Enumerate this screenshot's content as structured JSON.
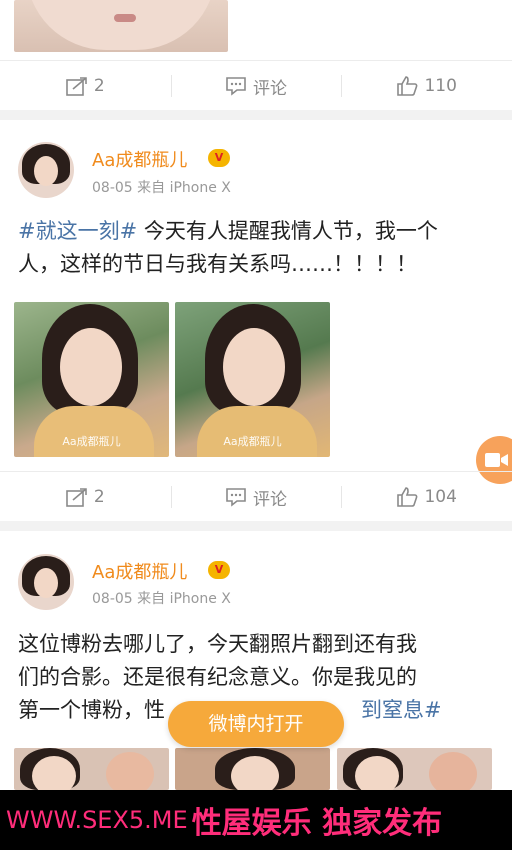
{
  "post1": {
    "actions": {
      "repost_count": "2",
      "comment_label": "评论",
      "like_count": "110"
    }
  },
  "post2": {
    "username": "Aa成都瓶儿",
    "badge": "V",
    "meta": "08-05 来自 iPhone X",
    "hashtag": "#就这一刻#",
    "text_line1_rest": " 今天有人提醒我情人节，我一个",
    "text_line2": "人，这样的节日与我有关系吗……！！！！",
    "images": [
      {
        "watermark": "Aa成都瓶儿"
      },
      {
        "watermark": "Aa成都瓶儿"
      }
    ],
    "actions": {
      "repost_count": "2",
      "comment_label": "评论",
      "like_count": "104"
    }
  },
  "post3": {
    "username": "Aa成都瓶儿",
    "badge": "V",
    "meta": "08-05 来自 iPhone X",
    "line1": "这位博粉去哪儿了，今天翻照片翻到还有我",
    "line2": "们的合影。还是很有纪念意义。你是我见的",
    "line3_start": "第一个博粉，",
    "line3_partial": "性",
    "line3_tag_tail": "到窒息#"
  },
  "open_in_weibo": "微博内打开",
  "banner": {
    "site": "WWW.SEX5.ME",
    "slogan": "性屋娱乐 独家发布"
  },
  "colors": {
    "accent_orange": "#f6a93b",
    "username": "#f08b1d",
    "hashtag": "#4a74a6",
    "banner_pink": "#ff2d7a"
  }
}
